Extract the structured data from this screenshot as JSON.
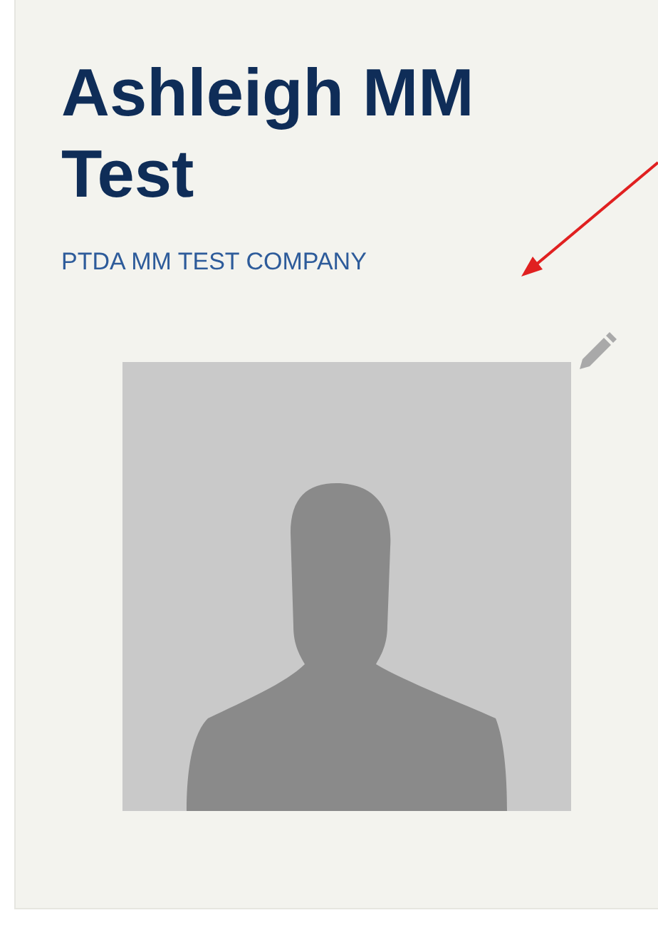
{
  "profile": {
    "name": "Ashleigh MM Test",
    "company": "PTDA MM TEST COMPANY"
  }
}
